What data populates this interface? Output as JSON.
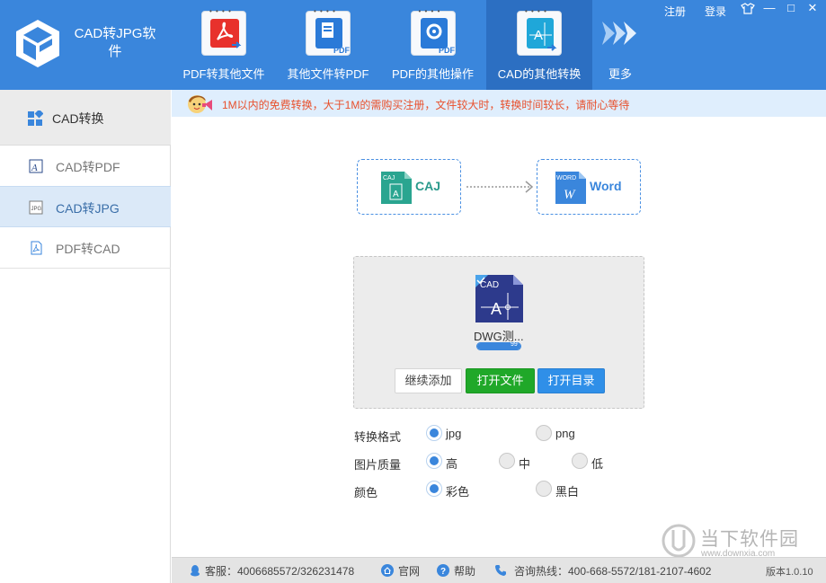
{
  "app": {
    "title": "CAD转JPG软件"
  },
  "window": {
    "register": "注册",
    "login": "登录",
    "skin_icon": "shirt-icon",
    "minimize": "—",
    "maximize": "□",
    "close": "✕"
  },
  "nav": {
    "items": [
      {
        "label": "PDF转其他文件",
        "icon": "pdf-acrobat-icon"
      },
      {
        "label": "其他文件转PDF",
        "icon": "doc-to-pdf-icon"
      },
      {
        "label": "PDF的其他操作",
        "icon": "pdf-gear-icon"
      },
      {
        "label": "CAD的其他转换",
        "icon": "cad-icon",
        "active": true
      }
    ],
    "more": "更多"
  },
  "sidebar": {
    "header": "CAD转换",
    "items": [
      {
        "label": "CAD转PDF"
      },
      {
        "label": "CAD转JPG",
        "active": true
      },
      {
        "label": "PDF转CAD"
      }
    ]
  },
  "notice": {
    "text": "1M以内的免费转换，大于1M的需购买注册，文件较大时，转换时间较长，请耐心等待"
  },
  "conversion": {
    "from": {
      "badge": "CAJ",
      "label": "CAJ"
    },
    "to": {
      "badge": "WORD",
      "label": "Word"
    }
  },
  "file": {
    "badge": "CAD",
    "name": "DWG测...",
    "progress": 1.0,
    "progress_label": "99"
  },
  "buttons": {
    "add": "继续添加",
    "open": "打开文件",
    "open_dir": "打开目录"
  },
  "options": {
    "format": {
      "label": "转换格式",
      "choices": [
        "jpg",
        "png"
      ],
      "selected": "jpg"
    },
    "quality": {
      "label": "图片质量",
      "choices": [
        "高",
        "中",
        "低"
      ],
      "selected": "高"
    },
    "color": {
      "label": "颜色",
      "choices": [
        "彩色",
        "黑白"
      ],
      "selected": "彩色"
    }
  },
  "status": {
    "support": "客服：4006685572/326231478",
    "website": "官网",
    "help": "帮助",
    "hotline": "咨询热线：400-668-5572/181-2107-4602",
    "version": "版本1.0.10"
  },
  "watermark": {
    "text": "当下软件园",
    "url": "www.downxia.com"
  },
  "colors": {
    "accent": "#3a86dc",
    "nav_active": "#2c6fc2",
    "notice": "#e8502c",
    "open_button": "#20a829",
    "dir_button": "#2f8fe8"
  }
}
